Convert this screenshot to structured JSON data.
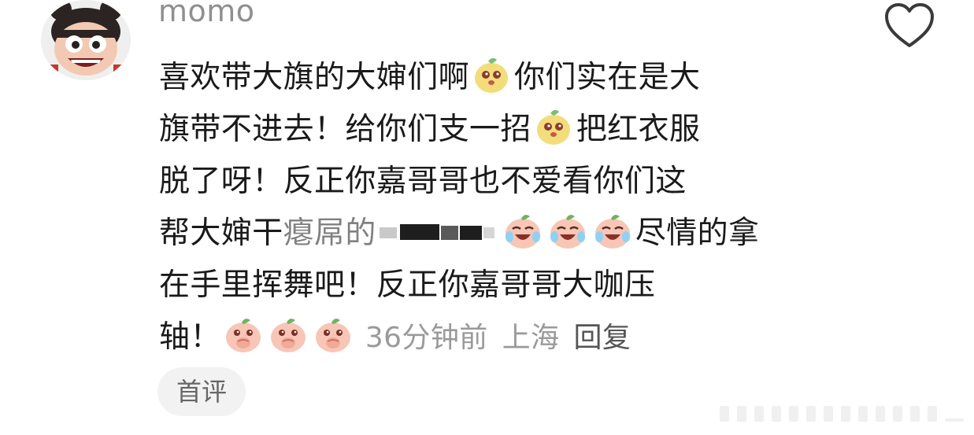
{
  "comment": {
    "username": "momo",
    "lines": [
      {
        "pre": "喜欢带大旗的大婶们啊",
        "post": "你们实在是大"
      },
      {
        "pre": "旗带不进去！给你们支一招",
        "post": "把红衣服"
      },
      {
        "text": "脱了呀！反正你嘉哥哥也不爱看你们这"
      },
      {
        "pre": "帮大婶干",
        "partial": "瘪屌的",
        "post": "尽情的拿"
      },
      {
        "text": "在手里挥舞吧！反正你嘉哥哥大咖压"
      },
      {
        "pre": "轴！"
      }
    ],
    "meta": {
      "time": "36分钟前",
      "location": "上海",
      "reply_label": "回复"
    },
    "tag_label": "首评"
  },
  "icons": {
    "like": "heart-outline-icon",
    "emoji_pear": "pear-face-emoji",
    "emoji_tears": "peach-laugh-cry-emoji",
    "emoji_cover": "peach-cover-mouth-emoji"
  },
  "colors": {
    "text": "#1a1a1a",
    "meta": "#9a9a9a",
    "username": "#8f8f8f",
    "tag_bg": "#f2f2f2",
    "peach": "#f7c6b6",
    "pear": "#f3dd7a"
  }
}
